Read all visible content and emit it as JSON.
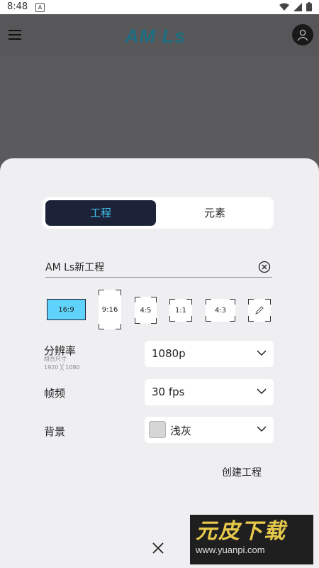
{
  "status_bar": {
    "time": "8:48",
    "notif_icon": "A"
  },
  "header": {
    "logo": "AM Ls"
  },
  "tabs": {
    "active": "工程",
    "inactive": "元素"
  },
  "project": {
    "name_value": "AM Ls新工程"
  },
  "ratios": [
    {
      "label": "16:9",
      "selected": true
    },
    {
      "label": "9:16",
      "selected": false
    },
    {
      "label": "4:5",
      "selected": false
    },
    {
      "label": "1:1",
      "selected": false
    },
    {
      "label": "4:3",
      "selected": false
    }
  ],
  "settings": {
    "resolution": {
      "label": "分辨率",
      "sub1": "组合尺寸",
      "sub2": "1920 ╳ 1080",
      "value": "1080p"
    },
    "framerate": {
      "label": "帧频",
      "value": "30 fps"
    },
    "background": {
      "label": "背景",
      "value": "浅灰",
      "swatch_color": "#d6d6d6"
    }
  },
  "actions": {
    "create": "创建工程"
  },
  "watermark": {
    "title": "元皮下载",
    "url": "www.yuanpi.com"
  },
  "colors": {
    "accent": "#3fc4ee",
    "active_tab_bg": "#1c2238",
    "selected_ratio": "#5fd3fb",
    "logo": "#1e6d80"
  }
}
